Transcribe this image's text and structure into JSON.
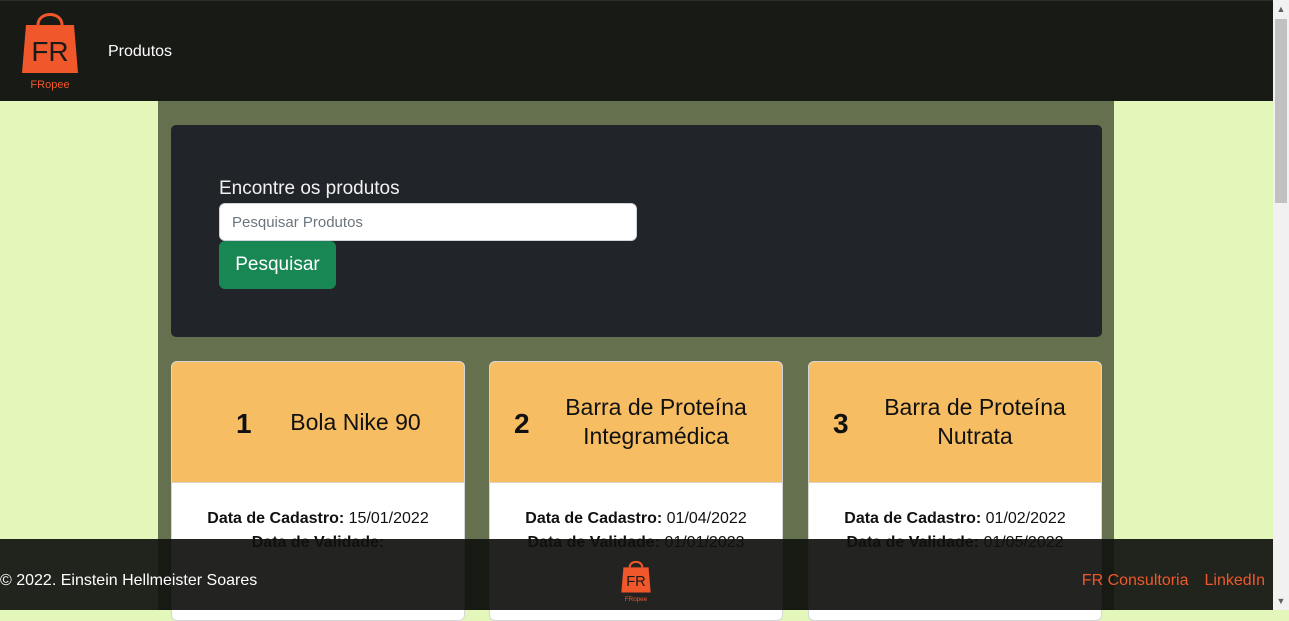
{
  "brand": {
    "name": "FR",
    "subtitle": "FRopee",
    "color": "#f0572a"
  },
  "nav": {
    "link_label": "Produtos"
  },
  "search": {
    "label": "Encontre os produtos",
    "placeholder": "Pesquisar Produtos",
    "button_label": "Pesquisar"
  },
  "cards": [
    {
      "number": "1",
      "title": "Bola Nike 90",
      "cadastro_label": "Data de Cadastro:",
      "cadastro_value": "15/01/2022",
      "validade_label": "Data de Validade:",
      "validade_value": ""
    },
    {
      "number": "2",
      "title": "Barra de Proteína Integramédica",
      "cadastro_label": "Data de Cadastro:",
      "cadastro_value": "01/04/2022",
      "validade_label": "Data de Validade:",
      "validade_value": "01/01/2023"
    },
    {
      "number": "3",
      "title": "Barra de Proteína Nutrata",
      "cadastro_label": "Data de Cadastro:",
      "cadastro_value": "01/02/2022",
      "validade_label": "Data de Validade:",
      "validade_value": "01/05/2022"
    }
  ],
  "footer": {
    "copyright": "© 2022. Einstein Hellmeister Soares",
    "links": [
      "FR Consultoria",
      "LinkedIn"
    ]
  },
  "colors": {
    "navbar": "#181a15",
    "main_bg": "#65704f",
    "page_bg": "#e2f7b9",
    "card_head": "#f6bd62",
    "button": "#198754"
  }
}
